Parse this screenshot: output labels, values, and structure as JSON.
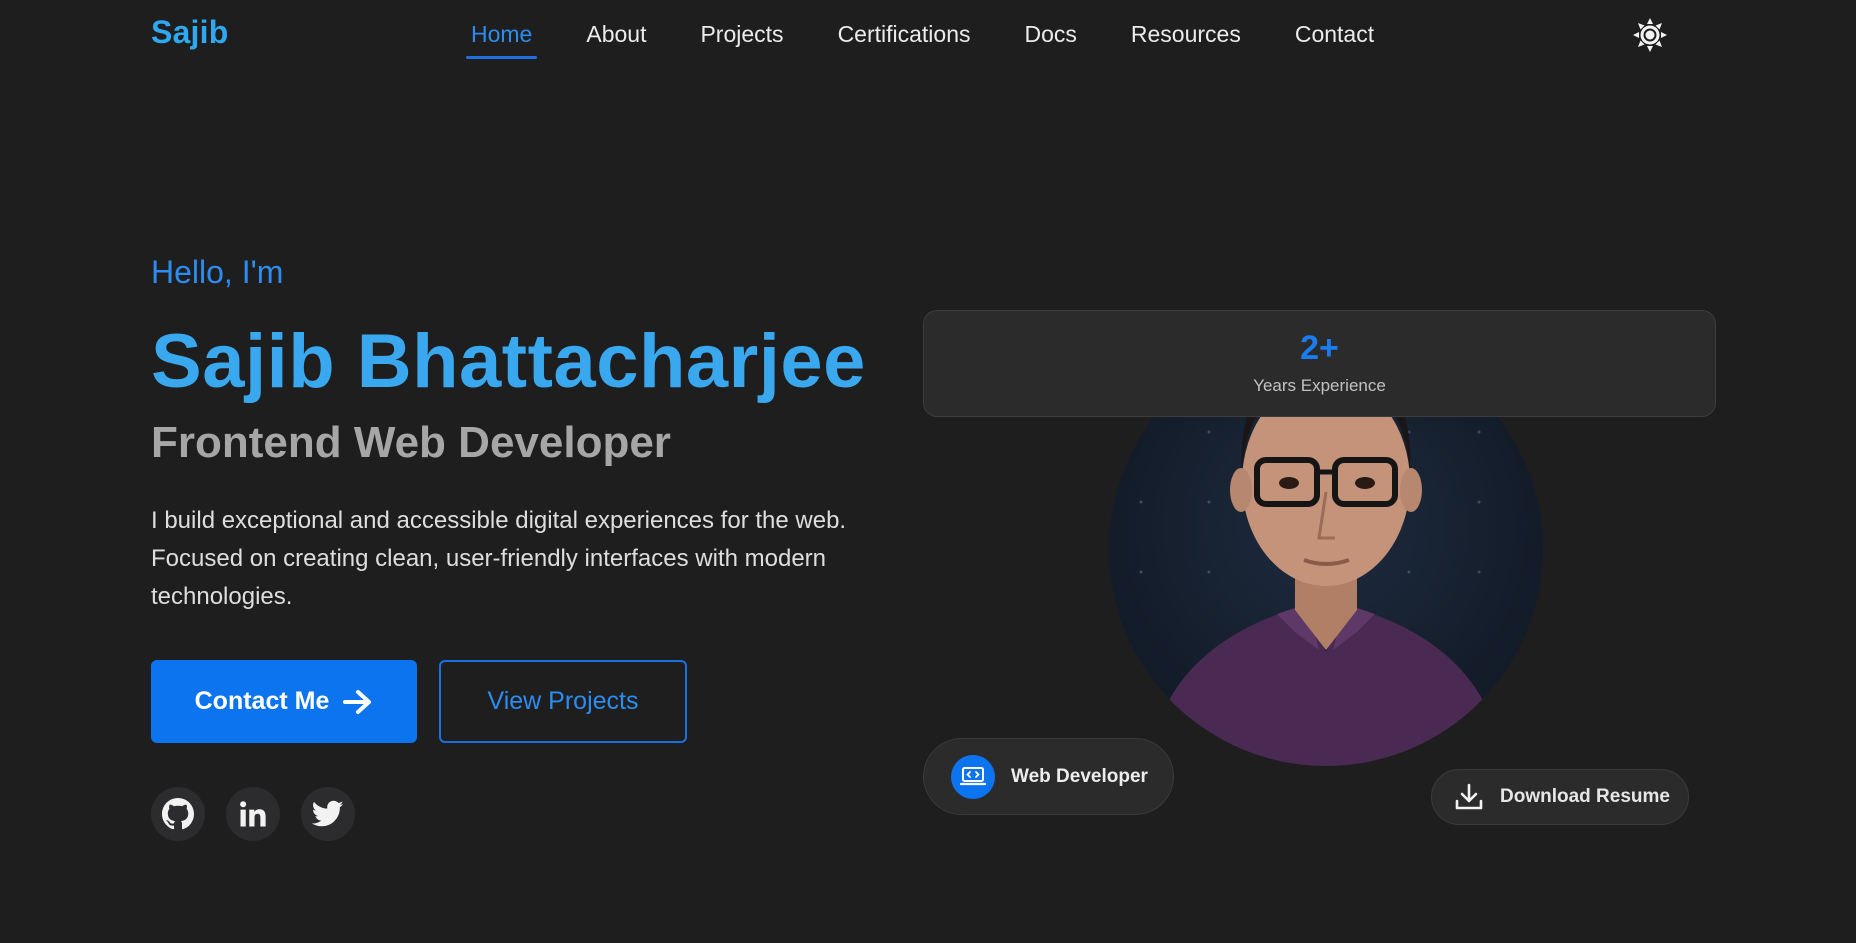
{
  "nav": {
    "logo": "Sajib",
    "links": [
      {
        "label": "Home",
        "active": true
      },
      {
        "label": "About"
      },
      {
        "label": "Projects"
      },
      {
        "label": "Certifications"
      },
      {
        "label": "Docs"
      },
      {
        "label": "Resources"
      },
      {
        "label": "Contact"
      }
    ],
    "theme_toggle_icon": "sun-icon"
  },
  "hero": {
    "greeting": "Hello, I'm",
    "name": "Sajib Bhattacharjee",
    "role": "Frontend Web Developer",
    "bio": "I build exceptional and accessible digital experiences for the web. Focused on creating clean, user-friendly interfaces with modern technologies.",
    "primary_button": "Contact Me",
    "secondary_button": "View Projects",
    "socials": [
      {
        "icon": "github-icon"
      },
      {
        "icon": "linkedin-icon"
      },
      {
        "icon": "twitter-icon"
      }
    ]
  },
  "profile": {
    "experience_value": "2+",
    "experience_label": "Years Experience",
    "badge_label": "Web Developer",
    "badge_icon": "code-laptop-icon",
    "download_label": "Download Resume",
    "download_icon": "download-icon"
  },
  "colors": {
    "background": "#1e1e1f",
    "accent": "#0d74f0",
    "name": "#3aa8ef"
  }
}
